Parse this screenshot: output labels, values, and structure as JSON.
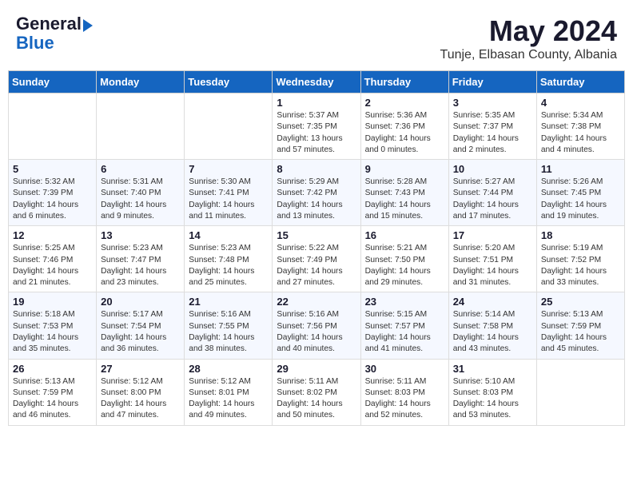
{
  "header": {
    "logo_line1": "General",
    "logo_line2": "Blue",
    "month": "May 2024",
    "location": "Tunje, Elbasan County, Albania"
  },
  "weekdays": [
    "Sunday",
    "Monday",
    "Tuesday",
    "Wednesday",
    "Thursday",
    "Friday",
    "Saturday"
  ],
  "weeks": [
    [
      {
        "day": "",
        "info": ""
      },
      {
        "day": "",
        "info": ""
      },
      {
        "day": "",
        "info": ""
      },
      {
        "day": "1",
        "info": "Sunrise: 5:37 AM\nSunset: 7:35 PM\nDaylight: 13 hours\nand 57 minutes."
      },
      {
        "day": "2",
        "info": "Sunrise: 5:36 AM\nSunset: 7:36 PM\nDaylight: 14 hours\nand 0 minutes."
      },
      {
        "day": "3",
        "info": "Sunrise: 5:35 AM\nSunset: 7:37 PM\nDaylight: 14 hours\nand 2 minutes."
      },
      {
        "day": "4",
        "info": "Sunrise: 5:34 AM\nSunset: 7:38 PM\nDaylight: 14 hours\nand 4 minutes."
      }
    ],
    [
      {
        "day": "5",
        "info": "Sunrise: 5:32 AM\nSunset: 7:39 PM\nDaylight: 14 hours\nand 6 minutes."
      },
      {
        "day": "6",
        "info": "Sunrise: 5:31 AM\nSunset: 7:40 PM\nDaylight: 14 hours\nand 9 minutes."
      },
      {
        "day": "7",
        "info": "Sunrise: 5:30 AM\nSunset: 7:41 PM\nDaylight: 14 hours\nand 11 minutes."
      },
      {
        "day": "8",
        "info": "Sunrise: 5:29 AM\nSunset: 7:42 PM\nDaylight: 14 hours\nand 13 minutes."
      },
      {
        "day": "9",
        "info": "Sunrise: 5:28 AM\nSunset: 7:43 PM\nDaylight: 14 hours\nand 15 minutes."
      },
      {
        "day": "10",
        "info": "Sunrise: 5:27 AM\nSunset: 7:44 PM\nDaylight: 14 hours\nand 17 minutes."
      },
      {
        "day": "11",
        "info": "Sunrise: 5:26 AM\nSunset: 7:45 PM\nDaylight: 14 hours\nand 19 minutes."
      }
    ],
    [
      {
        "day": "12",
        "info": "Sunrise: 5:25 AM\nSunset: 7:46 PM\nDaylight: 14 hours\nand 21 minutes."
      },
      {
        "day": "13",
        "info": "Sunrise: 5:23 AM\nSunset: 7:47 PM\nDaylight: 14 hours\nand 23 minutes."
      },
      {
        "day": "14",
        "info": "Sunrise: 5:23 AM\nSunset: 7:48 PM\nDaylight: 14 hours\nand 25 minutes."
      },
      {
        "day": "15",
        "info": "Sunrise: 5:22 AM\nSunset: 7:49 PM\nDaylight: 14 hours\nand 27 minutes."
      },
      {
        "day": "16",
        "info": "Sunrise: 5:21 AM\nSunset: 7:50 PM\nDaylight: 14 hours\nand 29 minutes."
      },
      {
        "day": "17",
        "info": "Sunrise: 5:20 AM\nSunset: 7:51 PM\nDaylight: 14 hours\nand 31 minutes."
      },
      {
        "day": "18",
        "info": "Sunrise: 5:19 AM\nSunset: 7:52 PM\nDaylight: 14 hours\nand 33 minutes."
      }
    ],
    [
      {
        "day": "19",
        "info": "Sunrise: 5:18 AM\nSunset: 7:53 PM\nDaylight: 14 hours\nand 35 minutes."
      },
      {
        "day": "20",
        "info": "Sunrise: 5:17 AM\nSunset: 7:54 PM\nDaylight: 14 hours\nand 36 minutes."
      },
      {
        "day": "21",
        "info": "Sunrise: 5:16 AM\nSunset: 7:55 PM\nDaylight: 14 hours\nand 38 minutes."
      },
      {
        "day": "22",
        "info": "Sunrise: 5:16 AM\nSunset: 7:56 PM\nDaylight: 14 hours\nand 40 minutes."
      },
      {
        "day": "23",
        "info": "Sunrise: 5:15 AM\nSunset: 7:57 PM\nDaylight: 14 hours\nand 41 minutes."
      },
      {
        "day": "24",
        "info": "Sunrise: 5:14 AM\nSunset: 7:58 PM\nDaylight: 14 hours\nand 43 minutes."
      },
      {
        "day": "25",
        "info": "Sunrise: 5:13 AM\nSunset: 7:59 PM\nDaylight: 14 hours\nand 45 minutes."
      }
    ],
    [
      {
        "day": "26",
        "info": "Sunrise: 5:13 AM\nSunset: 7:59 PM\nDaylight: 14 hours\nand 46 minutes."
      },
      {
        "day": "27",
        "info": "Sunrise: 5:12 AM\nSunset: 8:00 PM\nDaylight: 14 hours\nand 47 minutes."
      },
      {
        "day": "28",
        "info": "Sunrise: 5:12 AM\nSunset: 8:01 PM\nDaylight: 14 hours\nand 49 minutes."
      },
      {
        "day": "29",
        "info": "Sunrise: 5:11 AM\nSunset: 8:02 PM\nDaylight: 14 hours\nand 50 minutes."
      },
      {
        "day": "30",
        "info": "Sunrise: 5:11 AM\nSunset: 8:03 PM\nDaylight: 14 hours\nand 52 minutes."
      },
      {
        "day": "31",
        "info": "Sunrise: 5:10 AM\nSunset: 8:03 PM\nDaylight: 14 hours\nand 53 minutes."
      },
      {
        "day": "",
        "info": ""
      }
    ]
  ]
}
